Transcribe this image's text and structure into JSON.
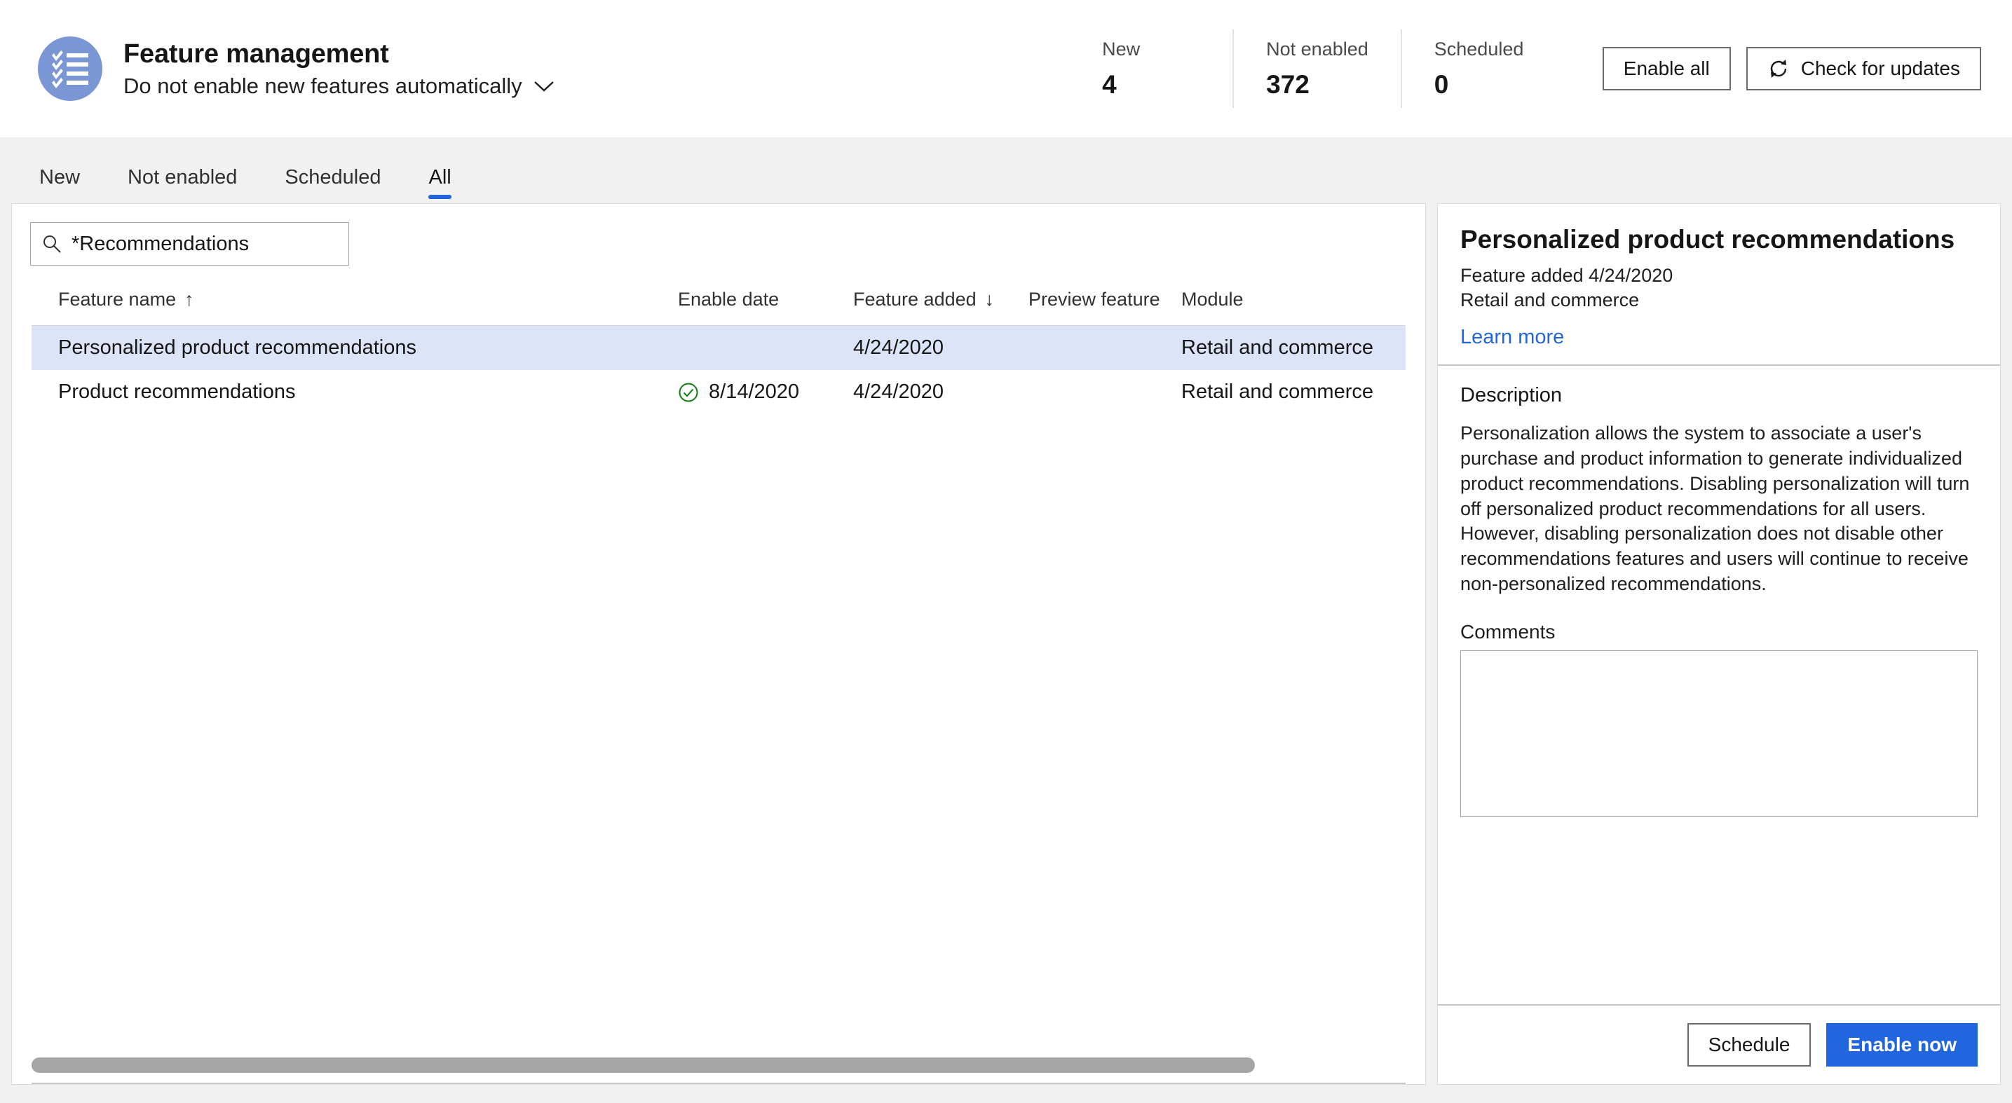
{
  "header": {
    "icon": "checklist-avatar-icon",
    "title": "Feature management",
    "subtitle": "Do not enable new features automatically",
    "subtitle_chevron": "chevron-down-icon",
    "stats": [
      {
        "label": "New",
        "value": "4"
      },
      {
        "label": "Not enabled",
        "value": "372"
      },
      {
        "label": "Scheduled",
        "value": "0"
      }
    ],
    "actions": {
      "enable_all": "Enable all",
      "check_updates": "Check for updates",
      "check_updates_icon": "refresh-icon"
    }
  },
  "tabs": [
    {
      "label": "New",
      "active": false
    },
    {
      "label": "Not enabled",
      "active": false
    },
    {
      "label": "Scheduled",
      "active": false
    },
    {
      "label": "All",
      "active": true
    }
  ],
  "search": {
    "icon": "search-icon",
    "value": "*Recommendations",
    "placeholder": "Filter"
  },
  "table": {
    "columns": [
      {
        "label": "Feature name",
        "sort": "↑"
      },
      {
        "label": "Enable date",
        "sort": ""
      },
      {
        "label": "Feature added",
        "sort": "↓"
      },
      {
        "label": "Preview feature",
        "sort": ""
      },
      {
        "label": "Module",
        "sort": ""
      }
    ],
    "rows": [
      {
        "name": "Personalized product recommendations",
        "enabled_icon": "",
        "enable_date": "",
        "feature_added": "4/24/2020",
        "preview_feature": "",
        "module": "Retail and commerce",
        "selected": true
      },
      {
        "name": "Product recommendations",
        "enabled_icon": "check-circle-icon",
        "enable_date": "8/14/2020",
        "feature_added": "4/24/2020",
        "preview_feature": "",
        "module": "Retail and commerce",
        "selected": false
      }
    ]
  },
  "detail": {
    "title": "Personalized product recommendations",
    "feature_added": "Feature added 4/24/2020",
    "module": "Retail and commerce",
    "learn_more": "Learn more",
    "description_label": "Description",
    "description": "Personalization allows the system to associate a user's purchase and product information to generate individualized product recommendations. Disabling personalization will turn off personalized product recommendations for all users. However, disabling personalization does not disable other recommendations features and users will continue to receive non-personalized recommendations.",
    "comments_label": "Comments",
    "comments_value": "",
    "footer": {
      "schedule": "Schedule",
      "enable_now": "Enable now"
    }
  },
  "colors": {
    "accent": "#2266dd",
    "avatar": "#7b96d4",
    "success": "#107c10",
    "row_selected": "#dce4f7",
    "page_bg": "#f1f1f1"
  }
}
